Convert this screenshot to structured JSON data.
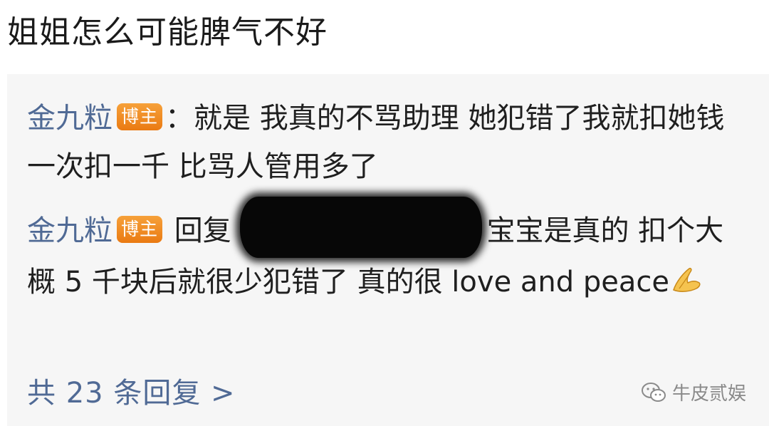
{
  "post": {
    "text": "姐姐怎么可能脾气不好"
  },
  "comments": [
    {
      "user": "金九粒",
      "badge": "博主",
      "separator": "：",
      "text": "就是 我真的不骂助理 她犯错了我就扣她钱 一次扣一千 比骂人管用多了"
    },
    {
      "user": "金九粒",
      "badge": "博主",
      "reply_prefix": "回复",
      "text": "宝宝是真的 扣个大概 5 千块后就很少犯错了 真的很 love and peace",
      "emoji": "praying-hands-icon"
    }
  ],
  "more_replies": "共 23 条回复 >",
  "watermark": {
    "text": "牛皮贰娱",
    "icon": "wechat-icon"
  },
  "colors": {
    "link": "#506a95",
    "badge": "#ee8320",
    "reply_box_bg": "#f6f6f6",
    "text": "#1f1f1f"
  }
}
